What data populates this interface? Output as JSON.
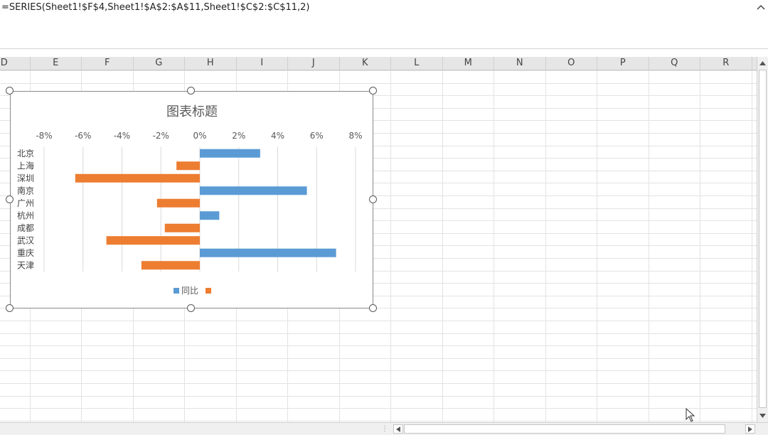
{
  "formula_bar": {
    "formula": "=SERIES(Sheet1!$F$4,Sheet1!$A$2:$A$11,Sheet1!$C$2:$C$11,2)",
    "collapse_icon": "chevron-up-icon"
  },
  "columns": [
    "D",
    "E",
    "F",
    "G",
    "H",
    "I",
    "J",
    "K",
    "L",
    "M",
    "N",
    "O",
    "P",
    "Q",
    "R"
  ],
  "colors": {
    "series_positive": "#5b9bd5",
    "series_negative": "#ed7d31",
    "gridline": "#d9d9d9",
    "cell_grid": "#e3e3e3",
    "header_bg": "#e6e6e6"
  },
  "chart_data": {
    "type": "bar",
    "orientation": "horizontal",
    "title": "图表标题",
    "categories": [
      "北京",
      "上海",
      "深圳",
      "南京",
      "广州",
      "杭州",
      "成都",
      "武汉",
      "重庆",
      "天津"
    ],
    "series": [
      {
        "name": "同比",
        "values": [
          0.031,
          -0.012,
          -0.064,
          0.055,
          -0.022,
          0.01,
          -0.018,
          -0.048,
          0.07,
          -0.03
        ]
      }
    ],
    "xlim": [
      -0.08,
      0.08
    ],
    "xticks": [
      -0.08,
      -0.06,
      -0.04,
      -0.02,
      0,
      0.02,
      0.04,
      0.06,
      0.08
    ],
    "tick_labels": [
      "-8%",
      "-6%",
      "-4%",
      "-2%",
      "0%",
      "2%",
      "4%",
      "6%",
      "8%"
    ],
    "axis_position": "top",
    "grid": true,
    "legend": {
      "placement": "bottom",
      "entries": [
        {
          "label": "同比",
          "color": "#5b9bd5"
        },
        {
          "label": "",
          "color": "#ed7d31"
        }
      ]
    }
  }
}
